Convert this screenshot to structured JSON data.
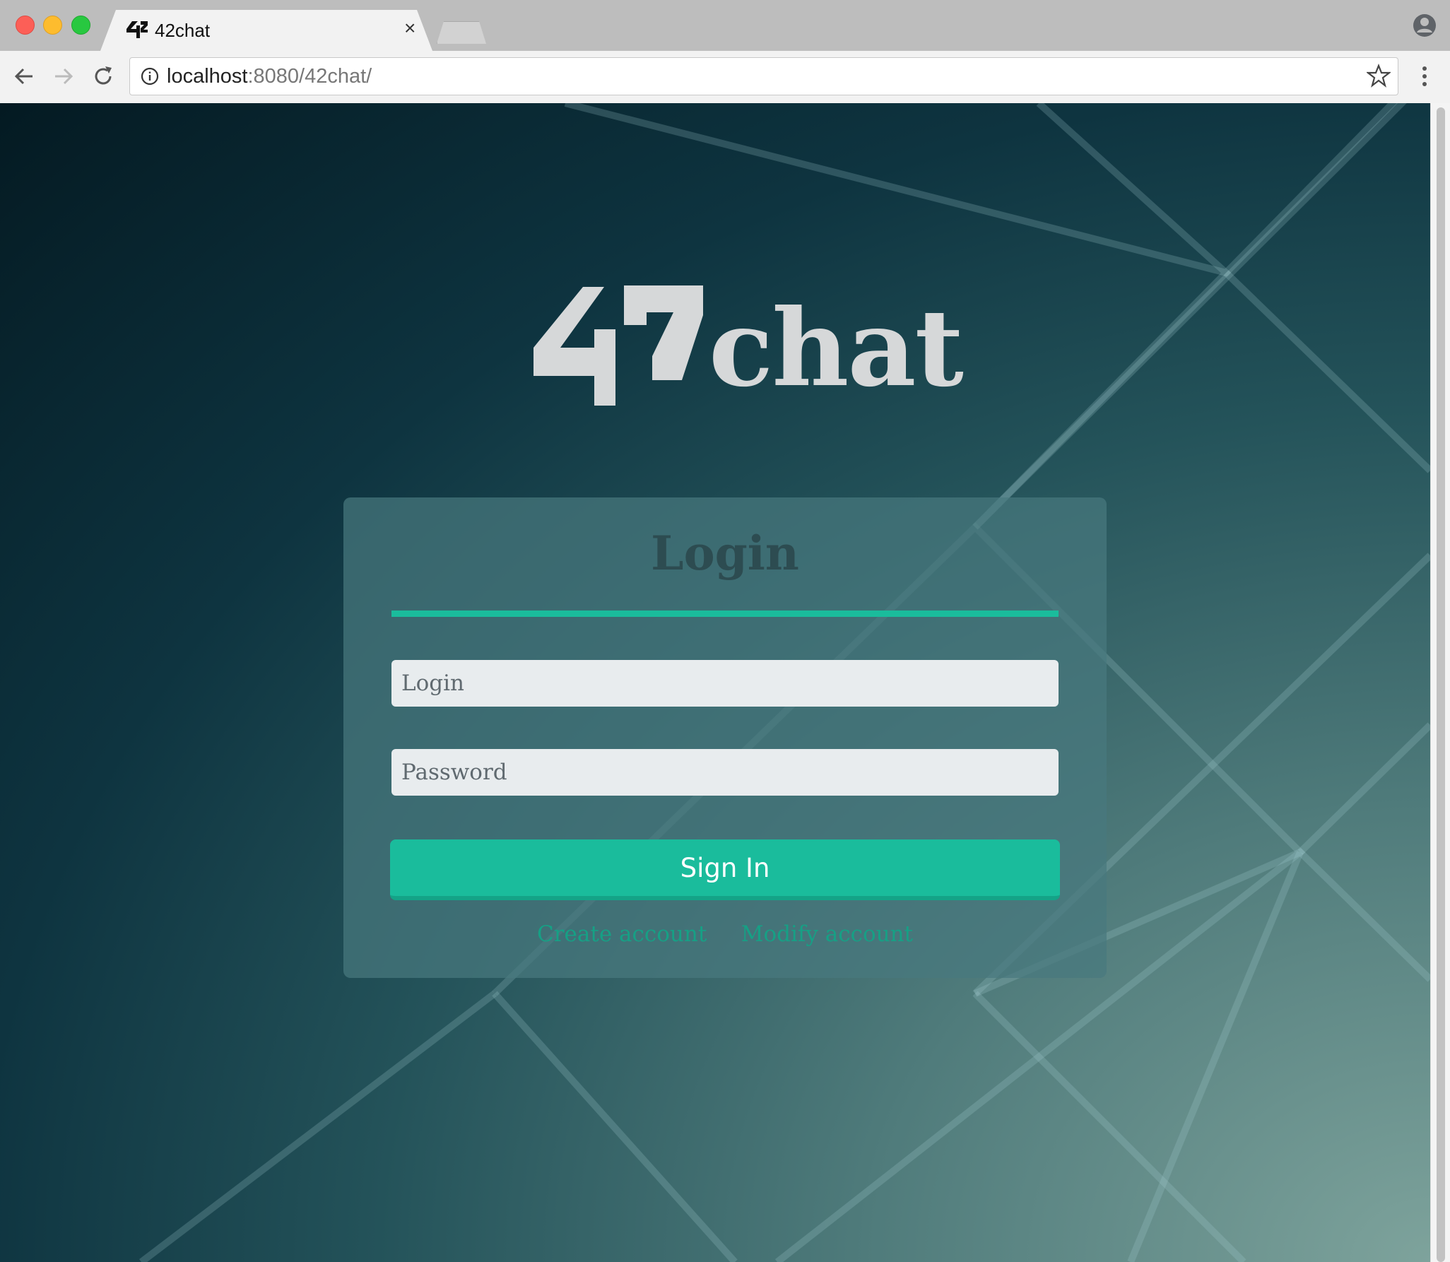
{
  "browser": {
    "tab": {
      "title": "42chat",
      "close_glyph": "×"
    },
    "address": {
      "host": "localhost",
      "path": ":8080/42chat/"
    }
  },
  "logo": {
    "brand_mark": "42",
    "word": "chat"
  },
  "login": {
    "title": "Login",
    "login_placeholder": "Login",
    "password_placeholder": "Password",
    "signin_label": "Sign In",
    "create_account_label": "Create account",
    "modify_account_label": "Modify account"
  },
  "colors": {
    "accent": "#1abc9c",
    "link": "#16a085",
    "card": "#48787e"
  },
  "icons": [
    "back-arrow-icon",
    "forward-arrow-icon",
    "reload-icon",
    "info-icon",
    "star-icon",
    "menu-icon",
    "profile-icon",
    "tab-close-icon"
  ]
}
